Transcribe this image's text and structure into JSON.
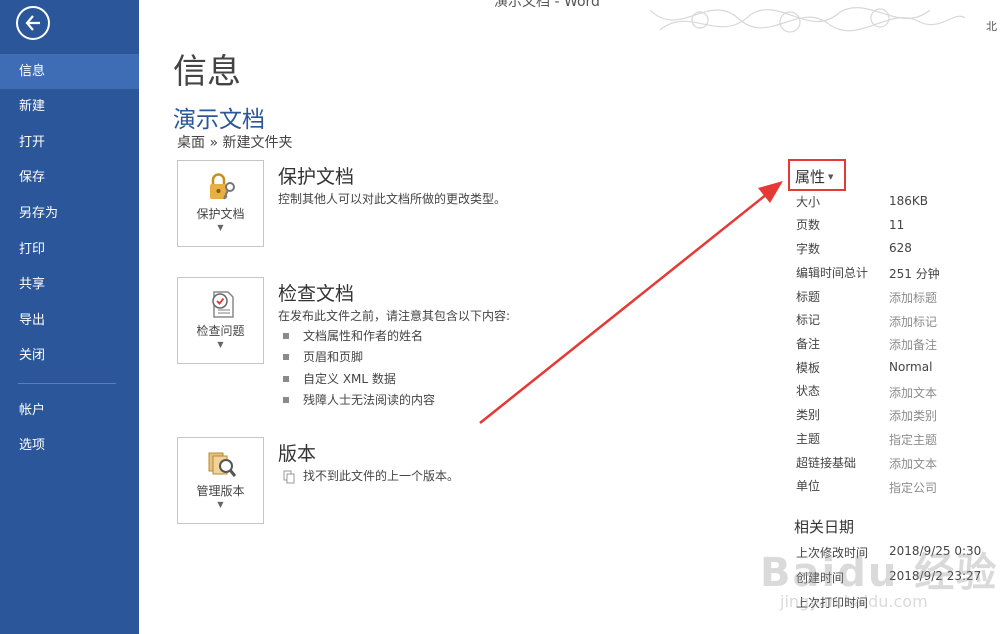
{
  "window": {
    "title": "演示文档 - Word",
    "corner_char": "北"
  },
  "nav": {
    "items": [
      {
        "label": "信息",
        "active": true
      },
      {
        "label": "新建"
      },
      {
        "label": "打开"
      },
      {
        "label": "保存"
      },
      {
        "label": "另存为"
      },
      {
        "label": "打印"
      },
      {
        "label": "共享"
      },
      {
        "label": "导出"
      },
      {
        "label": "关闭"
      }
    ],
    "lower_items": [
      {
        "label": "帐户"
      },
      {
        "label": "选项"
      }
    ]
  },
  "main": {
    "page_title": "信息",
    "doc_title": "演示文档",
    "breadcrumb": "桌面 » 新建文件夹",
    "protect": {
      "button_label": "保护文档",
      "heading": "保护文档",
      "description": "控制其他人可以对此文档所做的更改类型。",
      "icon": "lock-key-icon"
    },
    "inspect": {
      "button_label": "检查问题",
      "heading": "检查文档",
      "description": "在发布此文件之前，请注意其包含以下内容:",
      "bullets": [
        "文档属性和作者的姓名",
        "页眉和页脚",
        "自定义 XML 数据",
        "残障人士无法阅读的内容"
      ],
      "icon": "inspect-document-icon"
    },
    "versions": {
      "button_label": "管理版本",
      "heading": "版本",
      "description": "找不到此文件的上一个版本。",
      "icon": "manage-versions-icon"
    }
  },
  "properties": {
    "header": "属性",
    "rows": [
      {
        "label": "大小",
        "value": "186KB"
      },
      {
        "label": "页数",
        "value": "11"
      },
      {
        "label": "字数",
        "value": "628"
      },
      {
        "label": "编辑时间总计",
        "value": "251 分钟"
      },
      {
        "label": "标题",
        "value": "添加标题",
        "hint": true
      },
      {
        "label": "标记",
        "value": "添加标记",
        "hint": true
      },
      {
        "label": "备注",
        "value": "添加备注",
        "hint": true
      },
      {
        "label": "模板",
        "value": "Normal"
      },
      {
        "label": "状态",
        "value": "添加文本",
        "hint": true
      },
      {
        "label": "类别",
        "value": "添加类别",
        "hint": true
      },
      {
        "label": "主题",
        "value": "指定主题",
        "hint": true
      },
      {
        "label": "超链接基础",
        "value": "添加文本",
        "hint": true
      },
      {
        "label": "单位",
        "value": "指定公司",
        "hint": true
      }
    ],
    "dates_header": "相关日期",
    "dates": [
      {
        "label": "上次修改时间",
        "value": "2018/9/25 0:30"
      },
      {
        "label": "创建时间",
        "value": "2018/9/2 23:27"
      },
      {
        "label": "上次打印时间",
        "value": ""
      }
    ]
  },
  "watermark": {
    "brand": "Baidu 经验",
    "url": "jingyan.baidu.com"
  },
  "colors": {
    "nav_bg": "#2b579a",
    "nav_active": "#3e6db5",
    "accent_title": "#2b579a",
    "annotation_red": "#e53935"
  }
}
